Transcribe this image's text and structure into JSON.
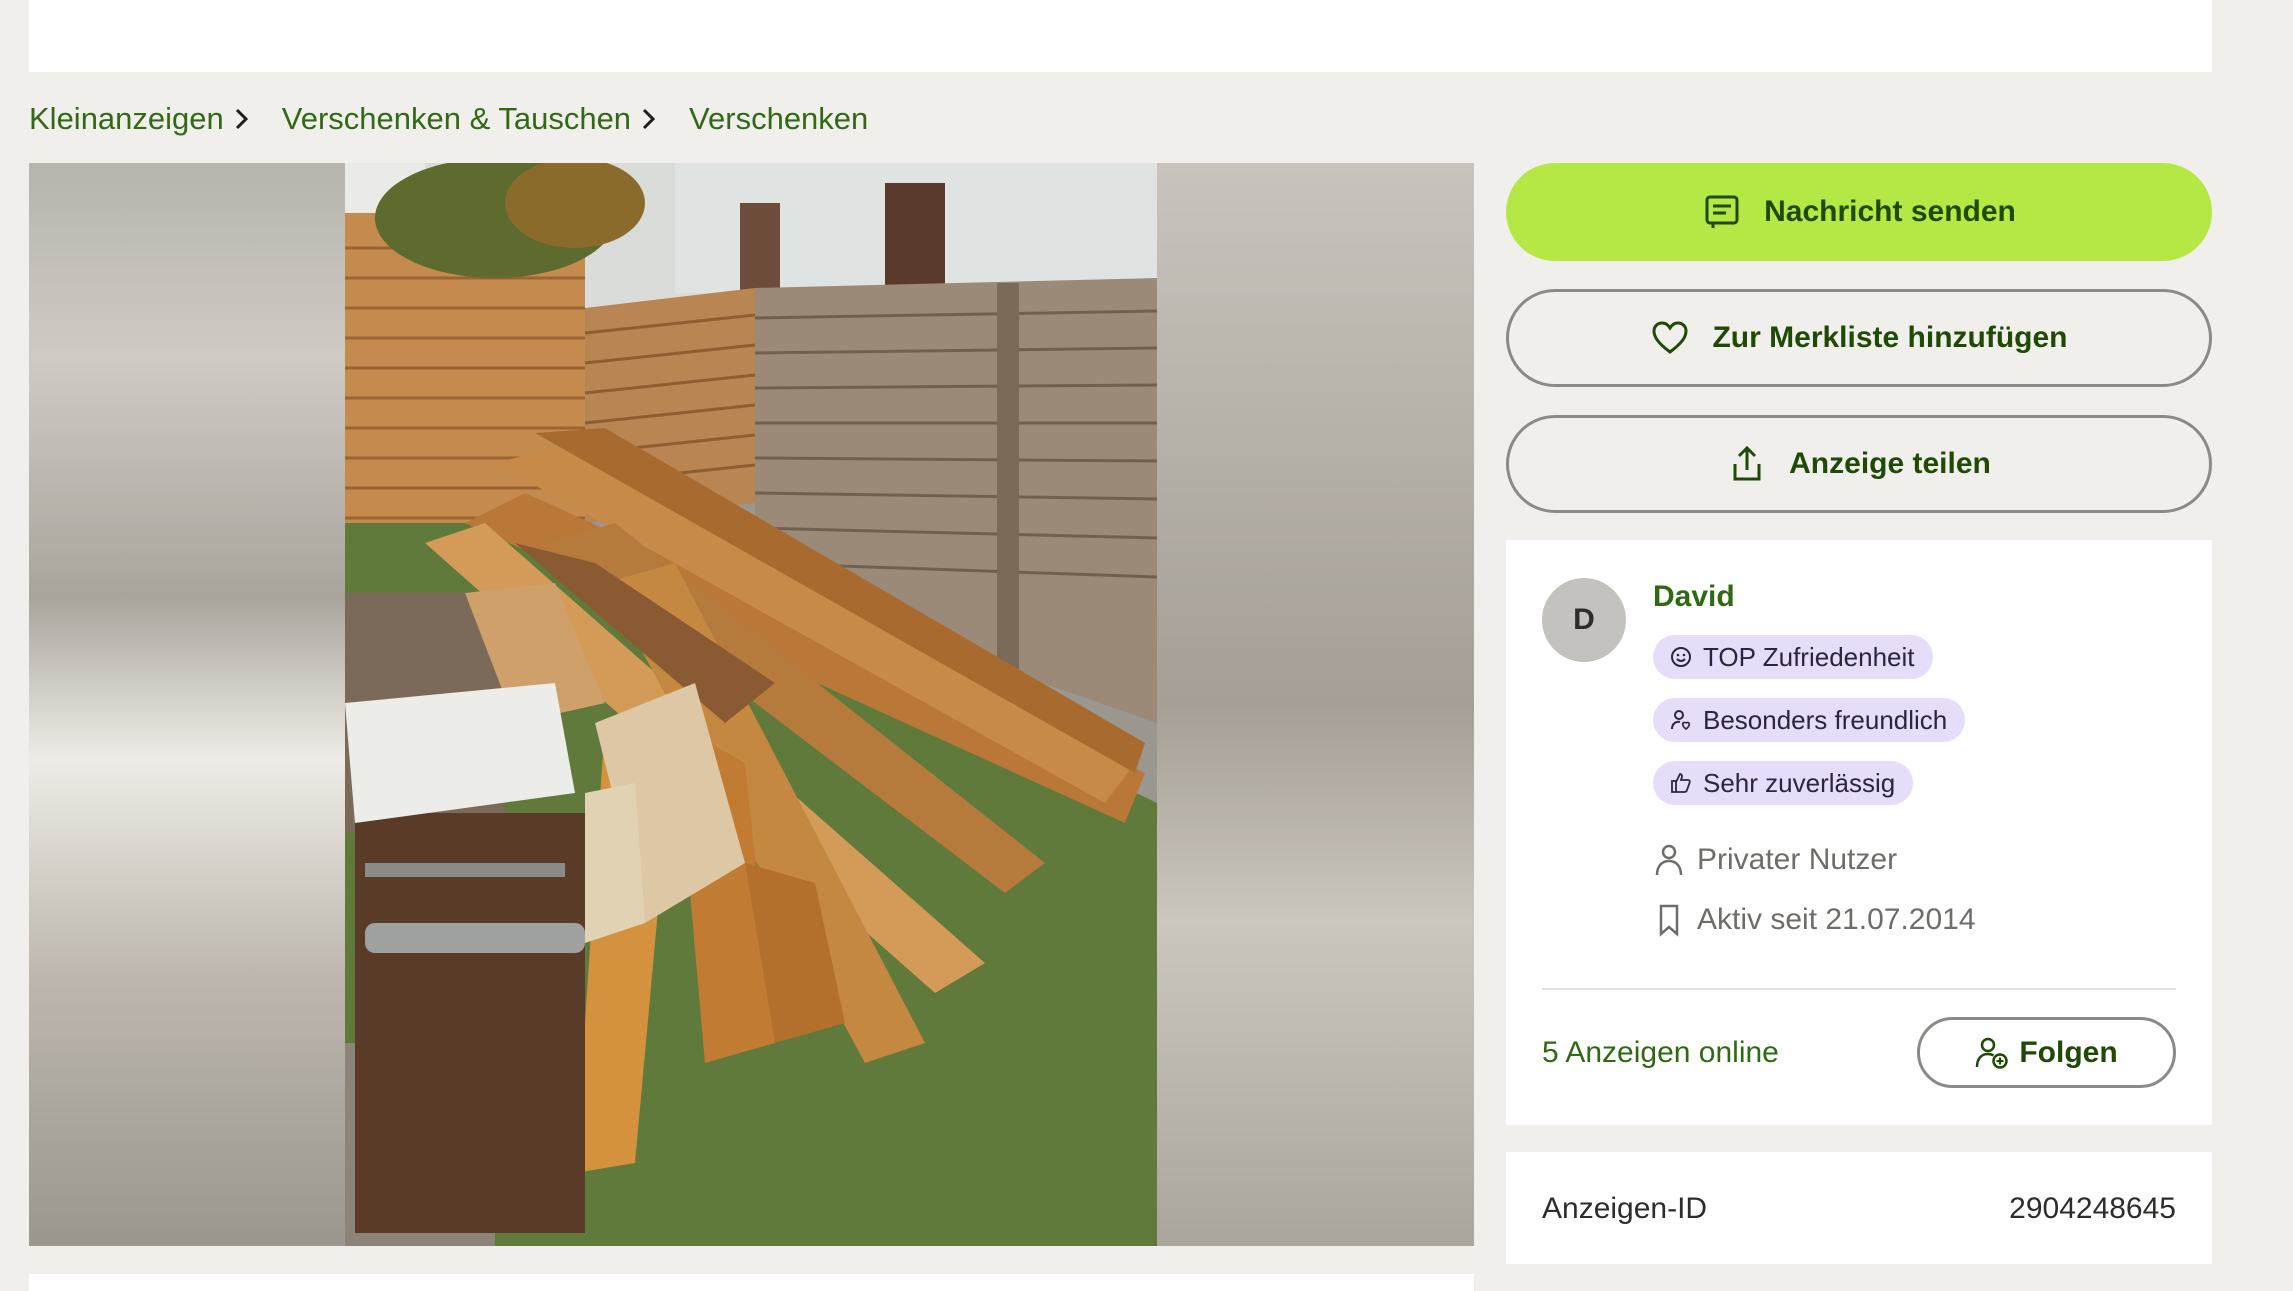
{
  "breadcrumb": {
    "items": [
      {
        "label": "Kleinanzeigen"
      },
      {
        "label": "Verschenken & Tauschen"
      },
      {
        "label": "Verschenken"
      }
    ]
  },
  "gallery": {
    "image_subject": "Pile of wooden boards next to a wooden fence"
  },
  "actions": {
    "send_message": "Nachricht senden",
    "add_to_watchlist": "Zur Merkliste hinzufügen",
    "share": "Anzeige teilen"
  },
  "seller": {
    "avatar_initial": "D",
    "name": "David",
    "badges": [
      {
        "label": "TOP Zufriedenheit",
        "icon": "smiley-icon"
      },
      {
        "label": "Besonders freundlich",
        "icon": "person-heart-icon"
      },
      {
        "label": "Sehr zuverlässig",
        "icon": "thumbs-up-icon"
      }
    ],
    "type": "Privater Nutzer",
    "active_since": "Aktiv seit 21.07.2014",
    "ads_online": "5 Anzeigen online",
    "follow_label": "Folgen"
  },
  "ad": {
    "id_label": "Anzeigen-ID",
    "id_value": "2904248645"
  },
  "colors": {
    "accent": "#b5e845",
    "link_green": "#326916",
    "badge_bg": "#e6ddfa",
    "page_bg": "#f1efec"
  }
}
